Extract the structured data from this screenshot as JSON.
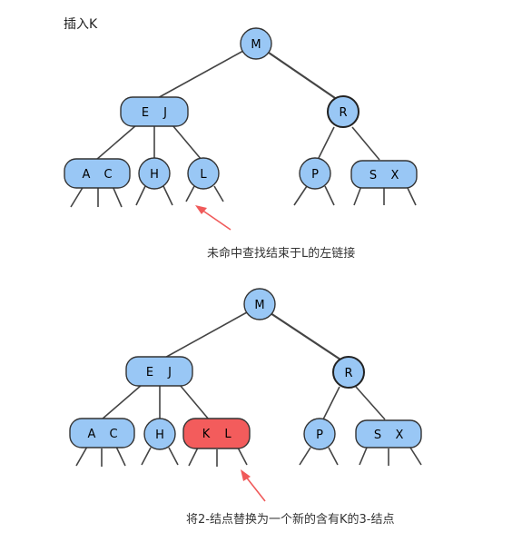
{
  "title": "插入K",
  "diagrams": [
    {
      "caption": "未命中查找结束于L的左链接",
      "nodes": [
        {
          "id": "M",
          "keys": [
            "M"
          ]
        },
        {
          "id": "EJ",
          "keys": [
            "E",
            "J"
          ]
        },
        {
          "id": "R",
          "keys": [
            "R"
          ]
        },
        {
          "id": "AC",
          "keys": [
            "A",
            "C"
          ]
        },
        {
          "id": "H",
          "keys": [
            "H"
          ]
        },
        {
          "id": "L",
          "keys": [
            "L"
          ]
        },
        {
          "id": "P",
          "keys": [
            "P"
          ]
        },
        {
          "id": "SX",
          "keys": [
            "S",
            "X"
          ]
        }
      ]
    },
    {
      "caption": "将2-结点替换为一个新的含有K的3-结点",
      "nodes": [
        {
          "id": "M",
          "keys": [
            "M"
          ]
        },
        {
          "id": "EJ",
          "keys": [
            "E",
            "J"
          ]
        },
        {
          "id": "R",
          "keys": [
            "R"
          ]
        },
        {
          "id": "AC",
          "keys": [
            "A",
            "C"
          ]
        },
        {
          "id": "H",
          "keys": [
            "H"
          ]
        },
        {
          "id": "KL",
          "keys": [
            "K",
            "L"
          ],
          "highlighted": true
        },
        {
          "id": "P",
          "keys": [
            "P"
          ]
        },
        {
          "id": "SX",
          "keys": [
            "S",
            "X"
          ]
        }
      ]
    }
  ],
  "colors": {
    "node_fill": "#99c7f5",
    "node_stroke": "#333333",
    "highlight_fill": "#f35c5c",
    "arrow": "#f05a5a",
    "edge": "#444444"
  }
}
